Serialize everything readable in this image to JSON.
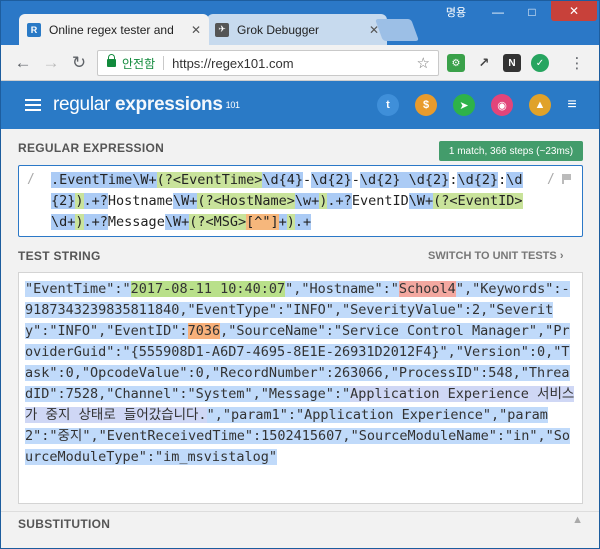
{
  "browser": {
    "lang": "명용",
    "tabs": [
      {
        "title": "Online regex tester and",
        "favicon": "R",
        "active": true
      },
      {
        "title": "Grok Debugger",
        "favicon": "✈",
        "active": false
      }
    ],
    "secure_label": "안전함",
    "url": "https://regex101.com"
  },
  "site": {
    "logo_part1": "regular",
    "logo_part2": " expressions",
    "logo_version": "101",
    "header_icons": [
      "twitter-icon",
      "dollar-icon",
      "telegram-icon",
      "github-icon",
      "bank-icon",
      "menu-icon"
    ]
  },
  "regex": {
    "section_label": "REGULAR EXPRESSION",
    "match_info": "1 match, 366 steps (~23ms)",
    "open_delim": "/",
    "close_delim": "/",
    "segments": [
      {
        "t": ".EventTime",
        "c": "rb"
      },
      {
        "t": "\\W+",
        "c": "rb"
      },
      {
        "t": "(?<EventTime>",
        "c": "rg"
      },
      {
        "t": "\\d{4}",
        "c": "rb"
      },
      {
        "t": "-",
        "c": ""
      },
      {
        "t": "\\d{2}",
        "c": "rb"
      },
      {
        "t": "-",
        "c": ""
      },
      {
        "t": "\\d{2} \\d{2}",
        "c": "rb"
      },
      {
        "t": ":",
        "c": ""
      },
      {
        "t": "\\d{2}",
        "c": "rb"
      },
      {
        "t": ":",
        "c": ""
      },
      {
        "t": "\\d{2}",
        "c": "rb"
      },
      {
        "t": ")",
        "c": "rg"
      },
      {
        "t": ".+?",
        "c": "rb"
      },
      {
        "t": "Hostname",
        "c": ""
      },
      {
        "t": "\\W+",
        "c": "rb"
      },
      {
        "t": "(?<HostName>",
        "c": "rg"
      },
      {
        "t": "\\w+",
        "c": "rb"
      },
      {
        "t": ")",
        "c": "rg"
      },
      {
        "t": ".+?",
        "c": "rb"
      },
      {
        "t": "EventID",
        "c": ""
      },
      {
        "t": "\\W+",
        "c": "rb"
      },
      {
        "t": "(?<EventID>",
        "c": "rg"
      },
      {
        "t": "\\d+",
        "c": "rb"
      },
      {
        "t": ")",
        "c": "rg"
      },
      {
        "t": ".+?",
        "c": "rb"
      },
      {
        "t": "Message",
        "c": ""
      },
      {
        "t": "\\W+",
        "c": "rb"
      },
      {
        "t": "(?<MSG>",
        "c": "rg"
      },
      {
        "t": "[^\"]",
        "c": "ro"
      },
      {
        "t": "+",
        "c": "rb"
      },
      {
        "t": ")",
        "c": "rg"
      },
      {
        "t": ".+",
        "c": "rb"
      }
    ]
  },
  "test": {
    "section_label": "TEST STRING",
    "switch_label": "SWITCH TO UNIT TESTS",
    "switch_icon": "chevron-right-icon",
    "segments": [
      {
        "t": "\"EventTime\":\"",
        "c": "m"
      },
      {
        "t": "2017-08-11 10:40:07",
        "c": "g1"
      },
      {
        "t": "\",\"Hostname\":\"",
        "c": "m"
      },
      {
        "t": "School4",
        "c": "g2"
      },
      {
        "t": "\",\"Keywords\":-9187343239835811840,\"EventType\":\"INFO\",\"SeverityValue\":2,\"Severity\":\"INFO\",\"EventID\":",
        "c": "m"
      },
      {
        "t": "7036",
        "c": "g3"
      },
      {
        "t": ",\"SourceName\":\"Service Control Manager\",\"ProviderGuid\":\"{555908D1-A6D7-4695-8E1E-26931D2012F4}\",\"Version\":0,\"Task\":0,\"OpcodeValue\":0,\"RecordNumber\":263066,\"ProcessID\":548,\"ThreadID\":7528,\"Channel\":\"System\",\"Message\":\"",
        "c": "m"
      },
      {
        "t": "Application Experience 서비스가 중지 상태로 들어갔습니다.",
        "c": "g4"
      },
      {
        "t": "\",\"param1\":\"Application Experience\",\"param2\":\"중지\",\"EventReceivedTime\":1502415607,\"SourceModuleName\":\"in\",\"SourceModuleType\":\"im_msvistalog\"",
        "c": "m"
      }
    ]
  },
  "substitution": {
    "section_label": "SUBSTITUTION"
  }
}
